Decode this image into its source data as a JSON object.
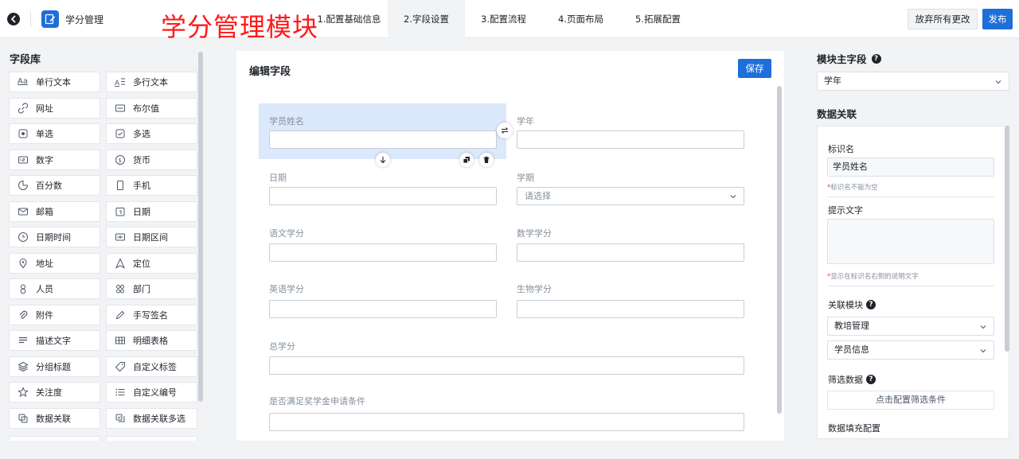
{
  "header": {
    "app_name": "学分管理",
    "overlay_title": "学分管理模块",
    "steps": [
      "1.配置基础信息",
      "2.字段设置",
      "3.配置流程",
      "4.页面布局",
      "5.拓展配置"
    ],
    "active_step": 1,
    "discard_label": "放弃所有更改",
    "publish_label": "发布",
    "brand_color": "#1e6fd9"
  },
  "library": {
    "title": "字段库",
    "items": [
      {
        "label": "单行文本",
        "icon": "single-line-text-icon"
      },
      {
        "label": "多行文本",
        "icon": "multi-line-text-icon"
      },
      {
        "label": "网址",
        "icon": "link-icon"
      },
      {
        "label": "布尔值",
        "icon": "boolean-icon"
      },
      {
        "label": "单选",
        "icon": "radio-icon"
      },
      {
        "label": "多选",
        "icon": "checkbox-icon"
      },
      {
        "label": "数字",
        "icon": "number-icon"
      },
      {
        "label": "货币",
        "icon": "currency-icon"
      },
      {
        "label": "百分数",
        "icon": "percent-icon"
      },
      {
        "label": "手机",
        "icon": "phone-icon"
      },
      {
        "label": "邮箱",
        "icon": "mail-icon"
      },
      {
        "label": "日期",
        "icon": "date-icon"
      },
      {
        "label": "日期时间",
        "icon": "clock-icon"
      },
      {
        "label": "日期区间",
        "icon": "date-range-icon"
      },
      {
        "label": "地址",
        "icon": "location-pin-icon"
      },
      {
        "label": "定位",
        "icon": "navigation-icon"
      },
      {
        "label": "人员",
        "icon": "person-icon"
      },
      {
        "label": "部门",
        "icon": "department-icon"
      },
      {
        "label": "附件",
        "icon": "paperclip-icon"
      },
      {
        "label": "手写签名",
        "icon": "pen-icon"
      },
      {
        "label": "描述文字",
        "icon": "description-icon"
      },
      {
        "label": "明细表格",
        "icon": "table-icon"
      },
      {
        "label": "分组标题",
        "icon": "layers-icon"
      },
      {
        "label": "自定义标签",
        "icon": "tag-icon"
      },
      {
        "label": "关注度",
        "icon": "star-icon"
      },
      {
        "label": "自定义编号",
        "icon": "list-icon"
      },
      {
        "label": "数据关联",
        "icon": "data-link-icon"
      },
      {
        "label": "数据关联多选",
        "icon": "data-link-multi-icon"
      }
    ]
  },
  "editor": {
    "title": "编辑字段",
    "save_label": "保存",
    "fields": {
      "student_name": "学员姓名",
      "school_year": "学年",
      "date": "日期",
      "semester": "学期",
      "semester_placeholder": "请选择",
      "chinese_credit": "语文学分",
      "math_credit": "数学学分",
      "english_credit": "英语学分",
      "biology_credit": "生物学分",
      "total_credit": "总学分",
      "scholarship": "是否满足奖学金申请条件"
    }
  },
  "right_panel": {
    "main_field_title": "模块主字段",
    "main_field_value": "学年",
    "relation_title": "数据关联",
    "identifier_label": "标识名",
    "identifier_value": "学员姓名",
    "identifier_hint": "标识名不能为空",
    "hint_text_label": "提示文字",
    "hint_text_desc": "显示在标识名右侧的说明文字",
    "related_module_label": "关联模块",
    "related_module_value": "教培管理",
    "related_form_value": "学员信息",
    "filter_label": "筛选数据",
    "filter_button": "点击配置筛选条件",
    "fill_config_label": "数据填充配置"
  }
}
